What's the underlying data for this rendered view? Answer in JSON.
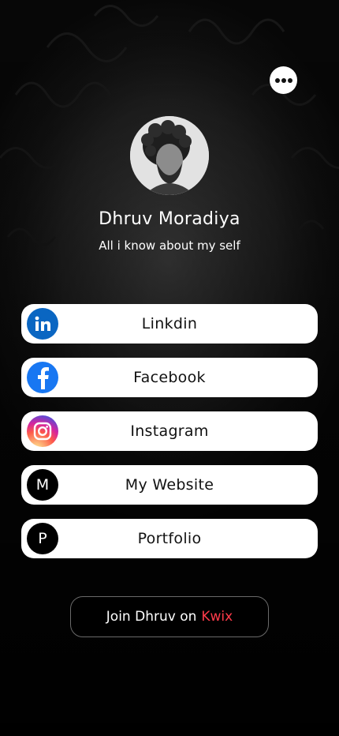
{
  "profile": {
    "name": "Dhruv Moradiya",
    "bio": "All i know about my self"
  },
  "header": {
    "more_icon": "more-horizontal-icon"
  },
  "links": [
    {
      "label": "Linkdin",
      "icon": "linkedin-icon",
      "color": "#0A66C2"
    },
    {
      "label": "Facebook",
      "icon": "facebook-icon",
      "color": "#1877F2"
    },
    {
      "label": "Instagram",
      "icon": "instagram-icon",
      "color": "#E1306C"
    },
    {
      "label": "My Website",
      "icon": "letter-m-icon",
      "letter": "M",
      "color": "#000000"
    },
    {
      "label": "Portfolio",
      "icon": "letter-p-icon",
      "letter": "P",
      "color": "#000000"
    }
  ],
  "join": {
    "prefix": "Join Dhruv on",
    "brand": "Kwix",
    "brand_color": "#FF3B4A"
  }
}
